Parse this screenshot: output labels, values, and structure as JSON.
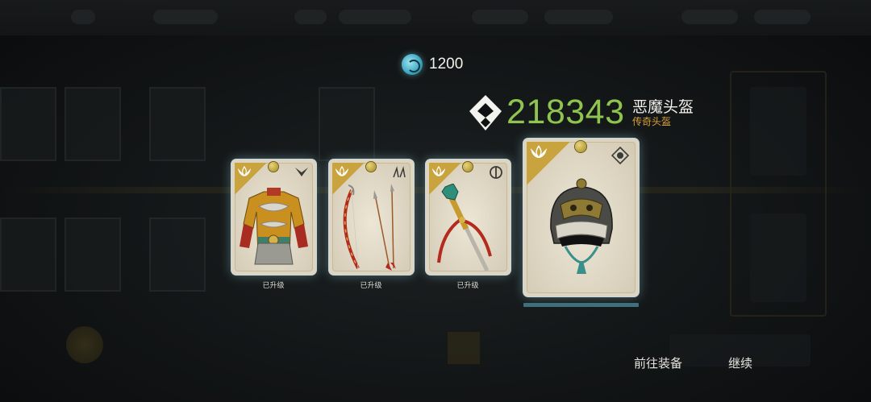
{
  "currency": {
    "icon": "swirl-currency-icon",
    "amount": "1200"
  },
  "item_header": {
    "power_icon": "diamond-power-icon",
    "power_value": "218343",
    "item_name": "恶魔头盔",
    "rarity_label": "传奇头盔",
    "power_color": "#8fc44f",
    "rarity_color": "#d8a23a"
  },
  "cards": [
    {
      "item": "armor",
      "type_icon": "chevron-down-icon",
      "caption": "已升级"
    },
    {
      "item": "bow",
      "type_icon": "arrows-icon",
      "caption": "已升级"
    },
    {
      "item": "staff",
      "type_icon": "half-circle-icon",
      "caption": "已升级"
    },
    {
      "item": "helmet",
      "type_icon": "target-icon",
      "caption": ""
    }
  ],
  "buttons": {
    "go_equip": "前往装备",
    "continue": "继续"
  },
  "accent": {
    "gold": "#c9a33d",
    "glow": "#a0dceb"
  }
}
